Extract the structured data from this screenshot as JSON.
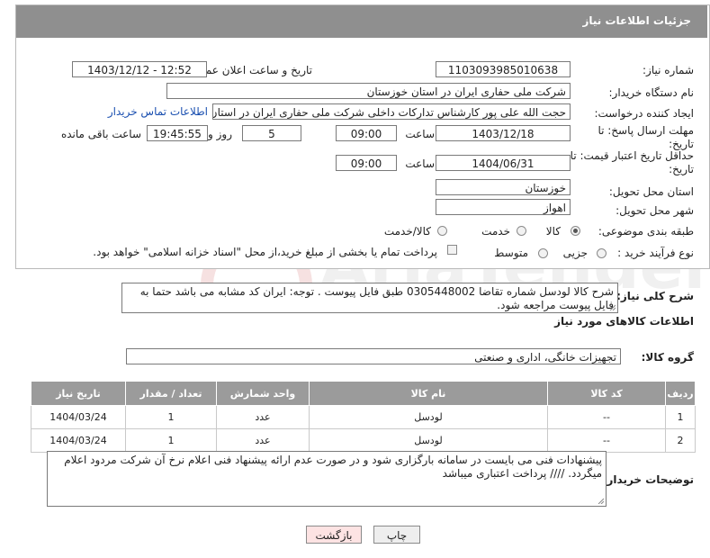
{
  "header": {
    "title": "جزئیات اطلاعات نیاز"
  },
  "fields": {
    "need_number": {
      "label": "شماره نیاز:",
      "value": "1103093985010638"
    },
    "announce_datetime": {
      "label": "تاریخ و ساعت اعلان عمومی:",
      "value": "1403/12/12 - 12:52"
    },
    "buyer_org": {
      "label": "نام دستگاه خریدار:",
      "value": "شرکت ملی حفاری ایران در استان خوزستان"
    },
    "requester": {
      "label": "ایجاد کننده درخواست:",
      "value": "حجت الله علی پور کارشناس تدارکات داخلی شرکت ملی حفاری ایران در استان",
      "link": "اطلاعات تماس خریدار"
    },
    "reply_deadline": {
      "label_line1": "مهلت ارسال پاسخ: تا",
      "label_line2": "تاریخ:",
      "date": "1403/12/18",
      "time_label": "ساعت",
      "time": "09:00",
      "days": "5",
      "days_label": "روز و",
      "remaining": "19:45:55",
      "remaining_label": "ساعت باقی مانده"
    },
    "price_validity": {
      "label_line1": "حداقل تاریخ اعتبار قیمت: تا",
      "label_line2": "تاریخ:",
      "date": "1404/06/31",
      "time_label": "ساعت",
      "time": "09:00"
    },
    "delivery_province": {
      "label": "استان محل تحویل:",
      "value": "خوزستان"
    },
    "delivery_city": {
      "label": "شهر محل تحویل:",
      "value": "اهواز"
    },
    "category": {
      "label": "طبقه بندی موضوعی:",
      "options": [
        "کالا",
        "خدمت",
        "کالا/خدمت"
      ],
      "selected": "کالا"
    },
    "purchase_type": {
      "label": "نوع فرآیند خرید :",
      "options": [
        "جزیی",
        "متوسط"
      ],
      "checkbox_text": "پرداخت تمام یا بخشی از مبلغ خرید،از محل \"اسناد خزانه اسلامی\" خواهد بود."
    }
  },
  "general_description": {
    "label": "شرح کلی نیاز:",
    "text": "شرح کالا لودسل شماره تقاضا 0305448002 طبق فایل پیوست . توجه: ایران کد مشابه می باشد حتما به فایل پیوست مراجعه شود."
  },
  "goods_section": {
    "title": "اطلاعات کالاهای مورد نیاز",
    "group_label": "گروه کالا:",
    "group_value": "تجهیزات خانگی، اداری و صنعتی"
  },
  "table": {
    "headers": [
      "ردیف",
      "کد کالا",
      "نام کالا",
      "واحد شمارش",
      "تعداد / مقدار",
      "تاریخ نیاز"
    ],
    "rows": [
      [
        "1",
        "--",
        "لودسل",
        "عدد",
        "1",
        "1404/03/24"
      ],
      [
        "2",
        "--",
        "لودسل",
        "عدد",
        "1",
        "1404/03/24"
      ]
    ]
  },
  "buyer_notes": {
    "label": "توضیحات خریدار:",
    "text": "پیشنهادات فنی می بایست در سامانه بارگزاری شود و در صورت عدم ارائه پیشنهاد فنی اعلام نرخ آن شرکت مردود اعلام میگردد.  //// پرداخت اعتباری میباشد"
  },
  "buttons": {
    "print": "چاپ",
    "back": "بازگشت"
  },
  "watermark": {
    "text": "AriaTender.net"
  },
  "colors": {
    "header_bg": "#8f8f8f",
    "table_header_bg": "#9b9b9b",
    "link": "#1a4fb0",
    "back_button_bg": "#fde3e3",
    "print_button_bg": "#eeeeee"
  }
}
